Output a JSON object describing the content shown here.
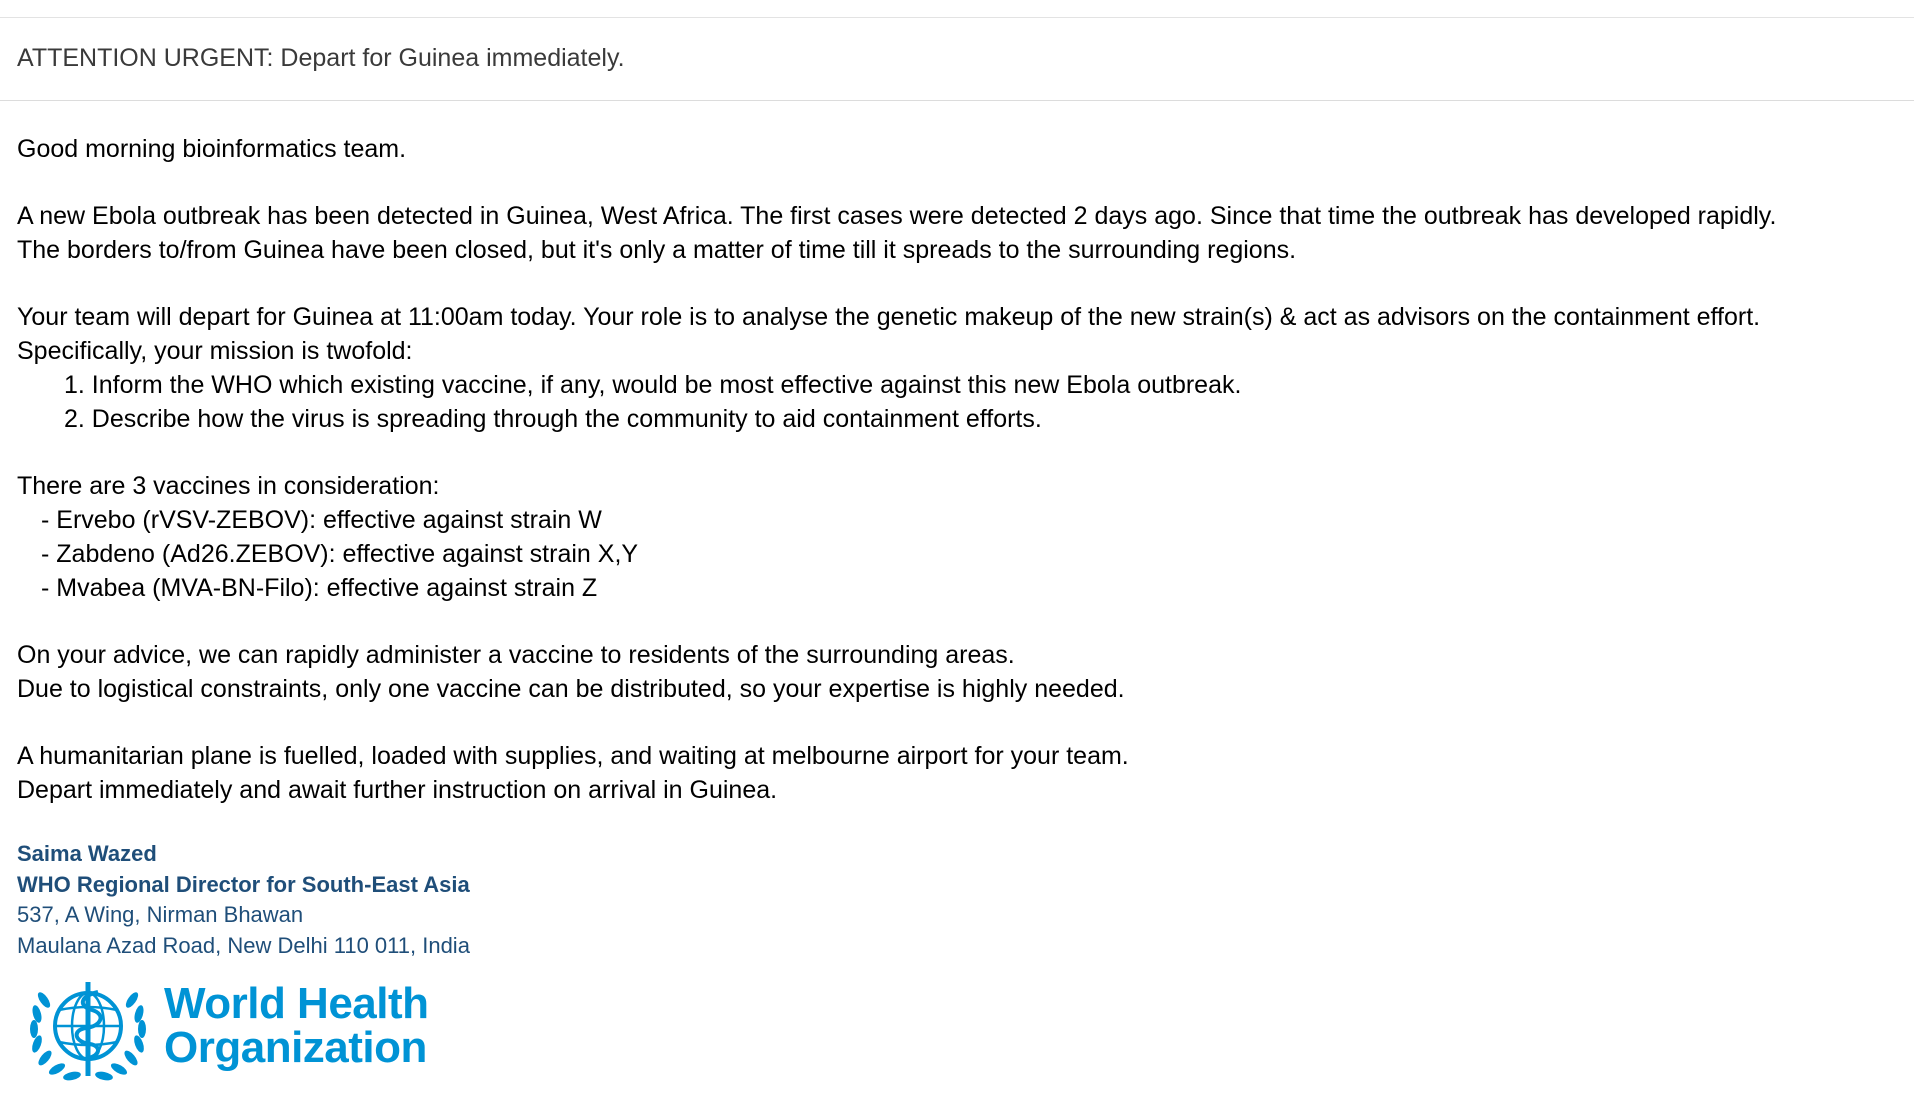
{
  "email": {
    "subject": "ATTENTION URGENT: Depart for Guinea immediately.",
    "greeting": "Good morning bioinformatics team.",
    "paragraph1": [
      "A new Ebola outbreak has been detected in Guinea, West Africa. The first cases were detected 2 days ago. Since that time the outbreak has developed rapidly.",
      "The borders to/from Guinea have been closed, but it's only a matter of time till it spreads to the surrounding regions."
    ],
    "paragraph2": [
      "Your team will depart for Guinea at 11:00am today. Your role is to analyse the genetic makeup of the new strain(s) & act as advisors on the containment effort.",
      "Specifically, your mission is twofold:"
    ],
    "mission_items": [
      "1. Inform the WHO which existing vaccine, if any, would be most effective against this new Ebola outbreak.",
      "2. Describe how the virus is spreading through the community to aid containment efforts."
    ],
    "vaccines_intro": "There are 3 vaccines in consideration:",
    "vaccines": [
      "- Ervebo (rVSV-ZEBOV):  effective against strain W",
      "- Zabdeno (Ad26.ZEBOV): effective against strain X,Y",
      "- Mvabea (MVA-BN-Filo): effective against strain Z"
    ],
    "paragraph3": [
      "On your advice, we can rapidly administer a vaccine to residents of the surrounding areas.",
      "Due to logistical constraints, only one vaccine can be distributed, so your expertise is highly needed."
    ],
    "paragraph4": [
      "A humanitarian plane is fuelled, loaded with supplies, and waiting at melbourne airport for your team.",
      "Depart immediately and await further instruction on arrival in Guinea."
    ]
  },
  "signature": {
    "name": "Saima Wazed",
    "title": "WHO Regional Director for South-East Asia",
    "address_line1": "537, A Wing, Nirman Bhawan",
    "address_line2": "Maulana Azad Road, New Delhi 110 011, India"
  },
  "logo": {
    "line1": "World Health",
    "line2": "Organization",
    "icon": "who-emblem-icon",
    "color": "#0093d5"
  },
  "colors": {
    "signature": "#1f4e79",
    "subject_text": "#3a3a3a"
  }
}
